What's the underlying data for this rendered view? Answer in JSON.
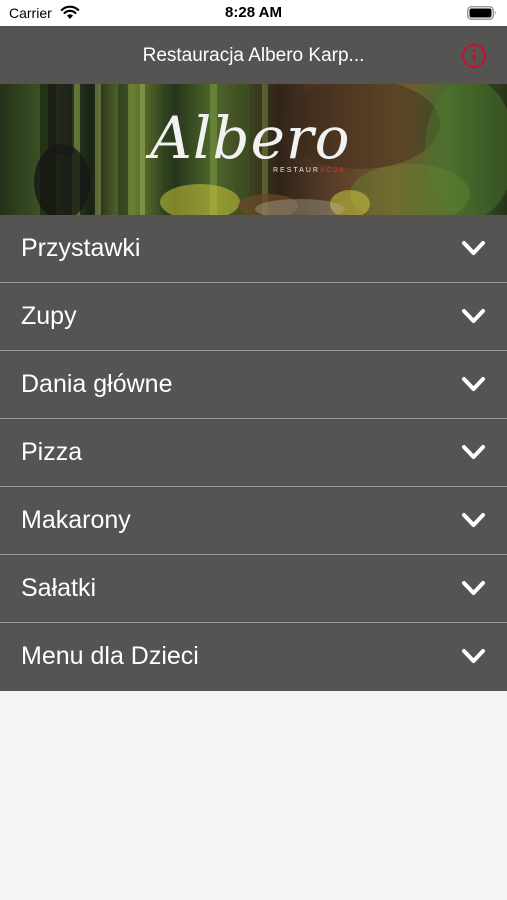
{
  "status_bar": {
    "carrier": "Carrier",
    "time": "8:28 AM"
  },
  "nav": {
    "title": "Restauracja Albero Karp..."
  },
  "hero": {
    "logo_text": "Albero",
    "logo_sub_main": "RESTAUR",
    "logo_sub_accent": "ACJA"
  },
  "menu": {
    "items": [
      {
        "label": "Przystawki"
      },
      {
        "label": "Zupy"
      },
      {
        "label": "Dania główne"
      },
      {
        "label": "Pizza"
      },
      {
        "label": "Makarony"
      },
      {
        "label": "Sałatki"
      },
      {
        "label": "Menu dla Dzieci"
      }
    ]
  },
  "colors": {
    "nav_bg": "#555453",
    "accent": "#c8102e",
    "separator": "#9a9a99",
    "page_bg": "#f4f4f4"
  }
}
